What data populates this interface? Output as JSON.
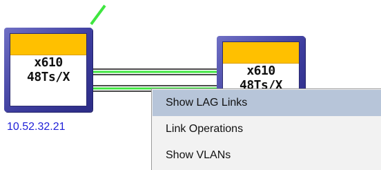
{
  "colors": {
    "link_green": "#3fe640",
    "device_frame": "#3d3d9e",
    "device_band": "#ffc000",
    "ip_text": "#1f1fd8",
    "menu_highlight": "#b7c5d9",
    "menu_bg": "#f2f2f2"
  },
  "devices": [
    {
      "model_line1": "x610",
      "model_line2": "48Ts/X",
      "ip": "10.52.32.21"
    },
    {
      "model_line1": "x610",
      "model_line2": "48Ts/X"
    }
  ],
  "context_menu": {
    "items": [
      {
        "label": "Show LAG Links",
        "highlighted": true
      },
      {
        "label": "Link Operations",
        "highlighted": false
      },
      {
        "label": "Show VLANs",
        "highlighted": false
      }
    ]
  }
}
